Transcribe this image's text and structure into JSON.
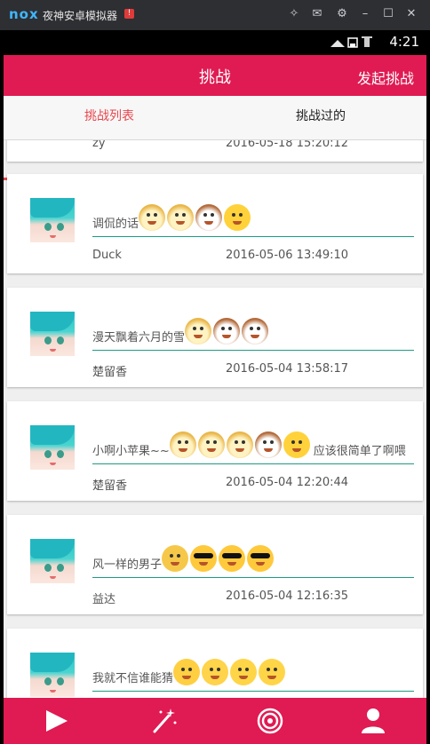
{
  "emulator": {
    "logo": "nox",
    "title": "夜神安卓模拟器",
    "badge": "!",
    "controls": [
      "pin-icon",
      "mail-icon",
      "gear-icon",
      "minimize-icon",
      "maximize-icon",
      "close-icon"
    ]
  },
  "status_bar": {
    "time": "4:21"
  },
  "app_bar": {
    "title": "挑战",
    "action": "发起挑战"
  },
  "tabs": [
    {
      "label": "挑战列表",
      "active": true
    },
    {
      "label": "挑战过的",
      "active": false
    }
  ],
  "challenges": [
    {
      "message": "",
      "emojis": [],
      "tail": "",
      "user": "zy",
      "time": "2016-05-18 15:20:12"
    },
    {
      "message": "调侃的话",
      "emojis": [
        "doge",
        "doge",
        "cat",
        "laugh"
      ],
      "tail": "",
      "user": "Duck",
      "time": "2016-05-06 13:49:10"
    },
    {
      "message": "漫天飘着六月的雪",
      "emojis": [
        "doge",
        "cat",
        "cat"
      ],
      "tail": "",
      "user": "楚留香",
      "time": "2016-05-04 13:58:17"
    },
    {
      "message": "小啊小苹果~~",
      "emojis": [
        "doge",
        "doge",
        "doge",
        "cat",
        "laugh"
      ],
      "tail": "应该很简单了啊喂",
      "user": "楚留香",
      "time": "2016-05-04 12:20:44"
    },
    {
      "message": "风一样的男子",
      "emojis": [
        "doubt",
        "cool",
        "cool",
        "cool"
      ],
      "tail": "",
      "user": "益达",
      "time": "2016-05-04 12:16:35"
    },
    {
      "message": "我就不信谁能猜",
      "emojis": [
        "shy",
        "sleepy",
        "hmm",
        "hmm"
      ],
      "tail": "",
      "user": "",
      "time": ""
    }
  ],
  "bottom_nav": [
    {
      "icon": "play-icon"
    },
    {
      "icon": "magic-wand-icon"
    },
    {
      "icon": "target-icon"
    },
    {
      "icon": "profile-icon"
    }
  ],
  "colors": {
    "accent": "#e01a52",
    "tab_active": "#e8474e",
    "divider": "#1e9b83"
  }
}
